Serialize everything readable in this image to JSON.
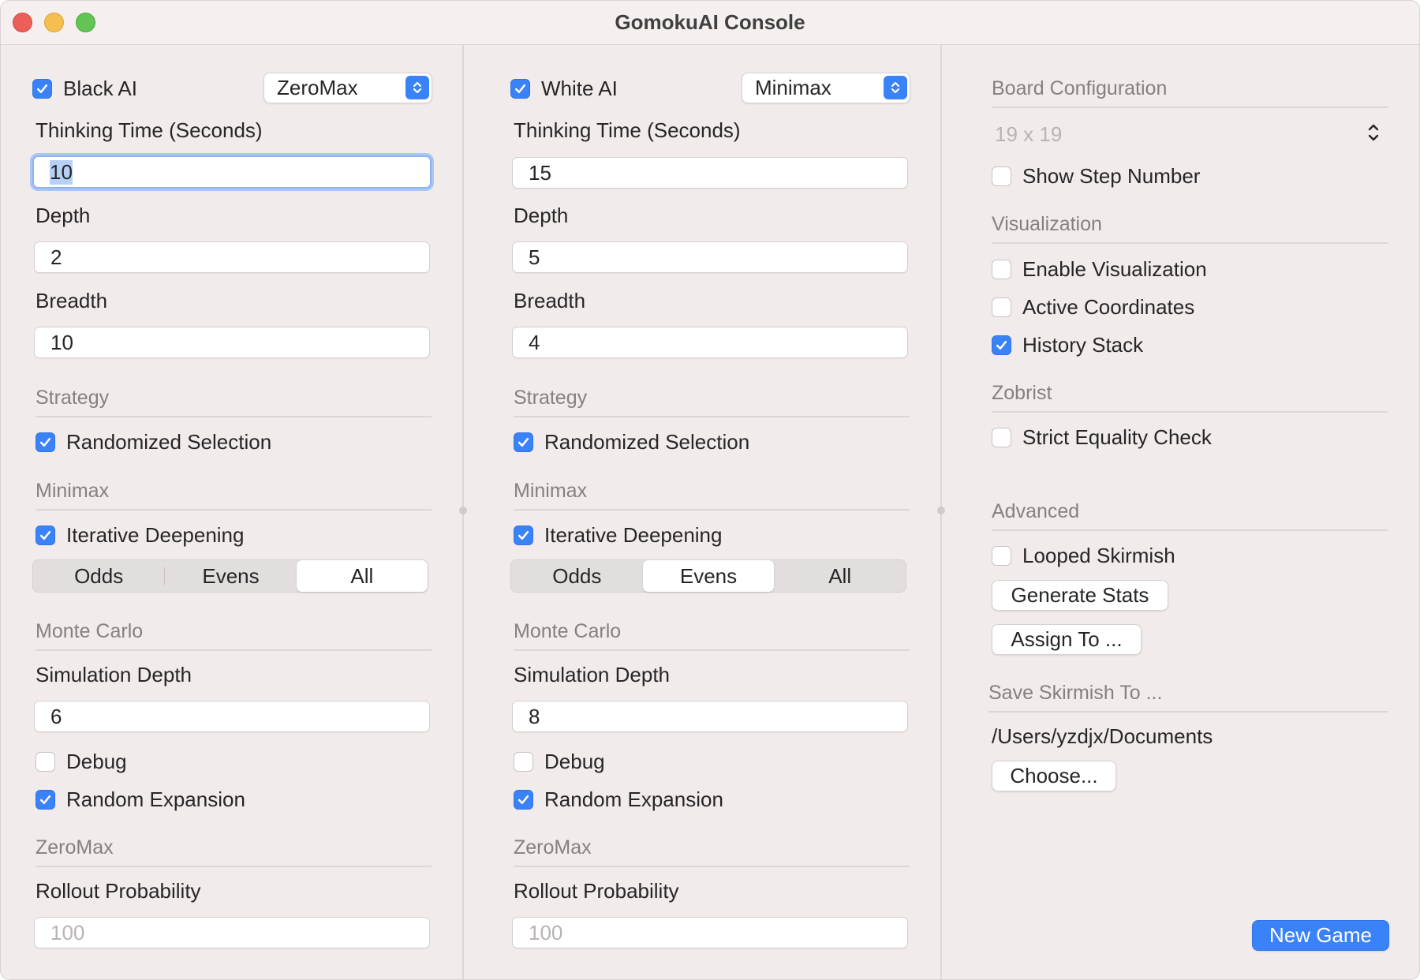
{
  "window": {
    "title": "GomokuAI Console"
  },
  "black": {
    "enabled_label": "Black AI",
    "algorithm": "ZeroMax",
    "thinking_time_label": "Thinking Time (Seconds)",
    "thinking_time": "10",
    "depth_label": "Depth",
    "depth": "2",
    "breadth_label": "Breadth",
    "breadth": "10",
    "strategy_section": "Strategy",
    "randomized_selection_label": "Randomized Selection",
    "minimax_section": "Minimax",
    "iterative_deepening_label": "Iterative Deepening",
    "segments": [
      "Odds",
      "Evens",
      "All"
    ],
    "selected_segment": "All",
    "monte_carlo_section": "Monte Carlo",
    "simulation_depth_label": "Simulation Depth",
    "simulation_depth": "6",
    "debug_label": "Debug",
    "random_expansion_label": "Random Expansion",
    "zeromax_section": "ZeroMax",
    "rollout_label": "Rollout Probability",
    "rollout_placeholder": "100"
  },
  "white": {
    "enabled_label": "White AI",
    "algorithm": "Minimax",
    "thinking_time_label": "Thinking Time (Seconds)",
    "thinking_time": "15",
    "depth_label": "Depth",
    "depth": "5",
    "breadth_label": "Breadth",
    "breadth": "4",
    "strategy_section": "Strategy",
    "randomized_selection_label": "Randomized Selection",
    "minimax_section": "Minimax",
    "iterative_deepening_label": "Iterative Deepening",
    "segments": [
      "Odds",
      "Evens",
      "All"
    ],
    "selected_segment": "Evens",
    "monte_carlo_section": "Monte Carlo",
    "simulation_depth_label": "Simulation Depth",
    "simulation_depth": "8",
    "debug_label": "Debug",
    "random_expansion_label": "Random Expansion",
    "zeromax_section": "ZeroMax",
    "rollout_label": "Rollout Probability",
    "rollout_placeholder": "100"
  },
  "settings": {
    "board_section": "Board Configuration",
    "board_size": "19 x 19",
    "show_step_label": "Show Step Number",
    "visualization_section": "Visualization",
    "enable_visualization_label": "Enable Visualization",
    "active_coordinates_label": "Active Coordinates",
    "history_stack_label": "History Stack",
    "zobrist_section": "Zobrist",
    "strict_equality_label": "Strict Equality Check",
    "advanced_section": "Advanced",
    "looped_skirmish_label": "Looped Skirmish",
    "generate_stats_label": "Generate Stats",
    "assign_to_label": "Assign To ...",
    "save_section": "Save Skirmish To ...",
    "save_path": "/Users/yzdjx/Documents",
    "choose_label": "Choose...",
    "new_game_label": "New Game"
  },
  "colors": {
    "accent": "#3a82f7",
    "window_bg": "#f1ebeb",
    "section_text": "#868080"
  }
}
